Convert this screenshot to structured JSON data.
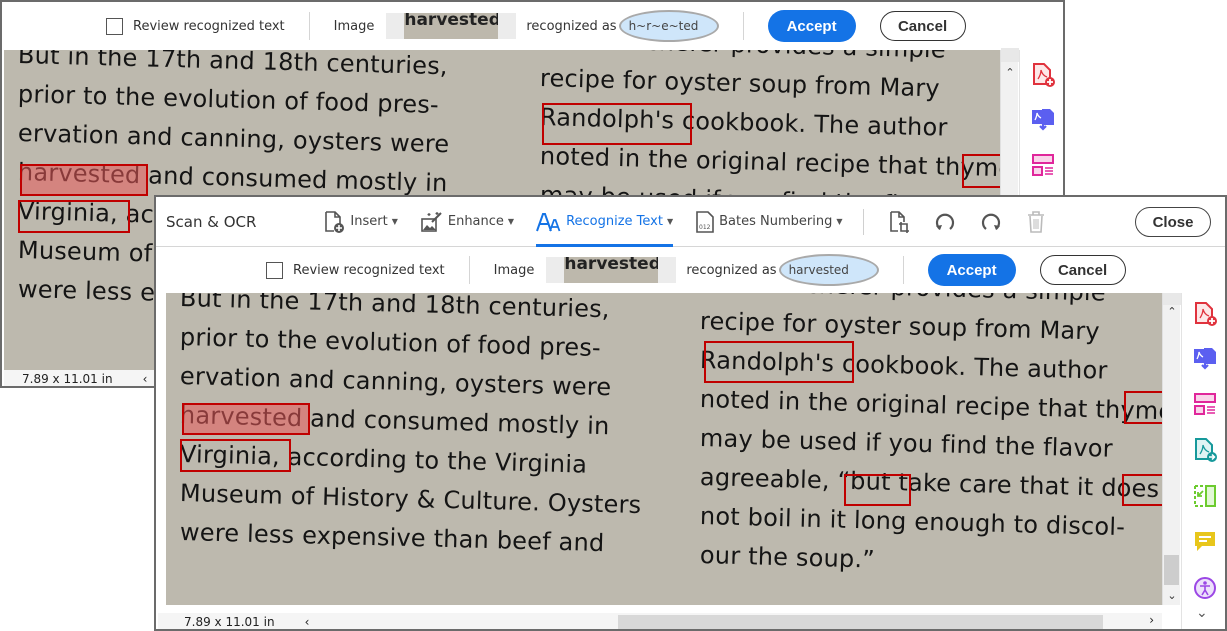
{
  "ocr_bar": {
    "review_label": "Review recognized text",
    "review_checked": false,
    "image_label": "Image",
    "image_snippet_text": "harvested",
    "recognized_as_label": "recognized as",
    "accept_label": "Accept",
    "cancel_label": "Cancel"
  },
  "back_window": {
    "recognized_value": "h~r~e~ted",
    "page_size": "7.89 x 11.01 in"
  },
  "front_window": {
    "toolbar": {
      "title": "Scan & OCR",
      "tools": [
        {
          "label": "Insert",
          "icon": "insert-page-icon"
        },
        {
          "label": "Enhance",
          "icon": "enhance-icon"
        },
        {
          "label": "Recognize Text",
          "icon": "recognize-text-icon",
          "active": true
        },
        {
          "label": "Bates Numbering",
          "icon": "bates-numbering-icon"
        }
      ],
      "close_label": "Close"
    },
    "recognized_value": "harvested",
    "page_size": "7.89 x 11.01 in"
  },
  "document": {
    "left_column": [
      "But in the 17th and 18th centuries,",
      "prior to the evolution of food pres-",
      "ervation and canning, oysters were",
      "harvested and consumed mostly in",
      "Virginia, according to the Virginia",
      "Museum of History & Culture. Oysters",
      "were less expensive than beef and"
    ],
    "right_column": [
      "Schefer provides a simple",
      "recipe for oyster soup from Mary",
      "Randolph's cookbook. The author",
      "noted in the original recipe that thyme",
      "may be used if you find the flavor",
      "agreeable, “but take care that it does",
      "not boil in it long enough to discol-",
      "our the soup.”"
    ],
    "suspects": [
      "harvested",
      "Virginia,",
      "Randolph's",
      "thy",
      "“but",
      "doe"
    ]
  },
  "right_rail": {
    "tools": [
      "create-pdf-icon",
      "export-pdf-icon",
      "organize-pages-icon",
      "send-pdf-icon",
      "compress-icon",
      "comment-icon",
      "accessibility-icon"
    ]
  },
  "colors": {
    "accent": "#1473e6",
    "suspect_box": "#c00000",
    "highlight": "#e85a5a",
    "recognized_field": "#cfe6fa"
  }
}
